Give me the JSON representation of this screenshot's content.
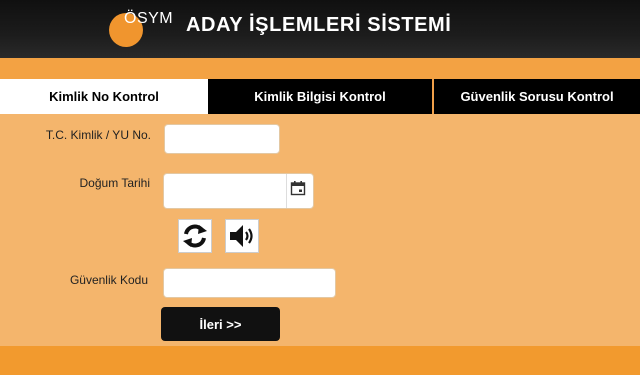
{
  "header": {
    "logo_text": "ÖSYM",
    "title": "ADAY İŞLEMLERİ SİSTEMİ"
  },
  "tabs": [
    {
      "label": "Kimlik No Kontrol",
      "active": true
    },
    {
      "label": "Kimlik Bilgisi Kontrol",
      "active": false
    },
    {
      "label": "Güvenlik Sorusu Kontrol",
      "active": false
    }
  ],
  "form": {
    "tc_label": "T.C. Kimlik / YU No.",
    "tc_value": "",
    "birth_label": "Doğum Tarihi",
    "birth_value": "",
    "captcha_label": "Güvenlik Kodu",
    "captcha_value": "",
    "next_button": "İleri >>"
  },
  "icons": {
    "calendar": "calendar-icon",
    "refresh": "refresh-icon",
    "audio": "speaker-icon"
  },
  "colors": {
    "background": "#f4b56c",
    "accent_band": "#f3a243",
    "header_bg": "#101010",
    "logo_orange": "#f0952e"
  }
}
